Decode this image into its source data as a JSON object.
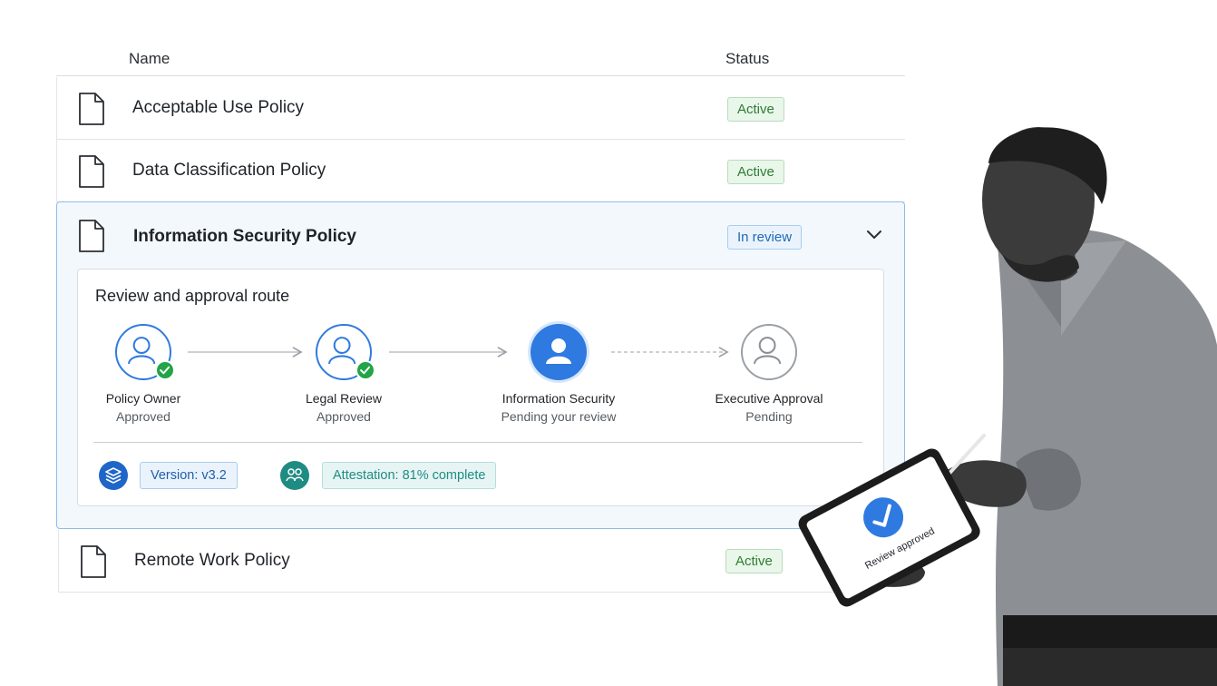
{
  "table": {
    "col_name": "Name",
    "col_status": "Status",
    "rows": [
      {
        "name": "Acceptable Use Policy",
        "status": "Active"
      },
      {
        "name": "Data Classification Policy",
        "status": "Active"
      },
      {
        "name": "Information Security Policy",
        "status": "In review"
      },
      {
        "name": "Remote Work Policy",
        "status": "Active"
      }
    ]
  },
  "route": {
    "title": "Review and approval route",
    "steps": [
      {
        "name": "Policy Owner",
        "status": "Approved"
      },
      {
        "name": "Legal Review",
        "status": "Approved"
      },
      {
        "name": "Information Security",
        "status": "Pending your review"
      },
      {
        "name": "Executive Approval",
        "status": "Pending"
      }
    ]
  },
  "meta": {
    "version": "Version: v3.2",
    "attestation": "Attestation: 81% complete"
  },
  "tablet": {
    "message": "Review approved"
  },
  "icons": {
    "document": "document-icon",
    "chevron": "chevron-down-icon",
    "user": "user-icon",
    "check": "check-icon",
    "layers": "layers-icon",
    "people": "people-icon"
  },
  "colors": {
    "accent": "#2f7ae0",
    "active_green": "#2e7d32",
    "review_blue": "#1e6ab8",
    "attest_teal": "#1f8c83",
    "approved_check": "#22a447"
  }
}
